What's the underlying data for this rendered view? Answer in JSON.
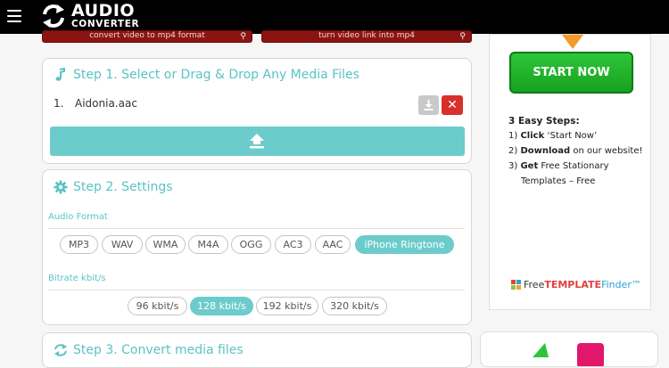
{
  "header": {
    "logo_line1": "AUDIO",
    "logo_line2": "CONVERTER"
  },
  "top_ads": [
    {
      "label": "convert video to mp4 format"
    },
    {
      "label": "turn video link into mp4"
    }
  ],
  "step1": {
    "title": "Step 1. Select or Drag & Drop Any Media Files",
    "files": [
      {
        "index": "1.",
        "name": "Aidonia.aac"
      }
    ]
  },
  "step2": {
    "title": "Step 2. Settings",
    "audio_format_label": "Audio Format",
    "formats": [
      "MP3",
      "WAV",
      "WMA",
      "M4A",
      "OGG",
      "AC3",
      "AAC",
      "iPhone Ringtone"
    ],
    "selected_format": "iPhone Ringtone",
    "bitrate_label": "Bitrate kbit/s",
    "bitrates": [
      "96 kbit/s",
      "128 kbit/s",
      "192 kbit/s",
      "320 kbit/s"
    ],
    "selected_bitrate": "128 kbit/s"
  },
  "step3": {
    "title": "Step 3. Convert media files"
  },
  "sidebar_ad": {
    "button": "START NOW",
    "steps_title": "3 Easy Steps:",
    "steps": [
      {
        "num": "1)",
        "bold": "Click",
        "text": " ‘Start Now’",
        "cont": ""
      },
      {
        "num": "2)",
        "bold": "Download",
        "text": " on our website!",
        "cont": ""
      },
      {
        "num": "3)",
        "bold": "Get",
        "text": " Free Stationary",
        "cont": "Templates – Free"
      }
    ],
    "brand_free": "Free",
    "brand_template": "TEMPLATE",
    "brand_finder": "Finder™"
  },
  "colors": {
    "accent": "#6ccccb",
    "accent_text": "#5ac3c5",
    "remove": "#d9302c",
    "start_button": "#1fb428",
    "top_bar": "#000000"
  }
}
